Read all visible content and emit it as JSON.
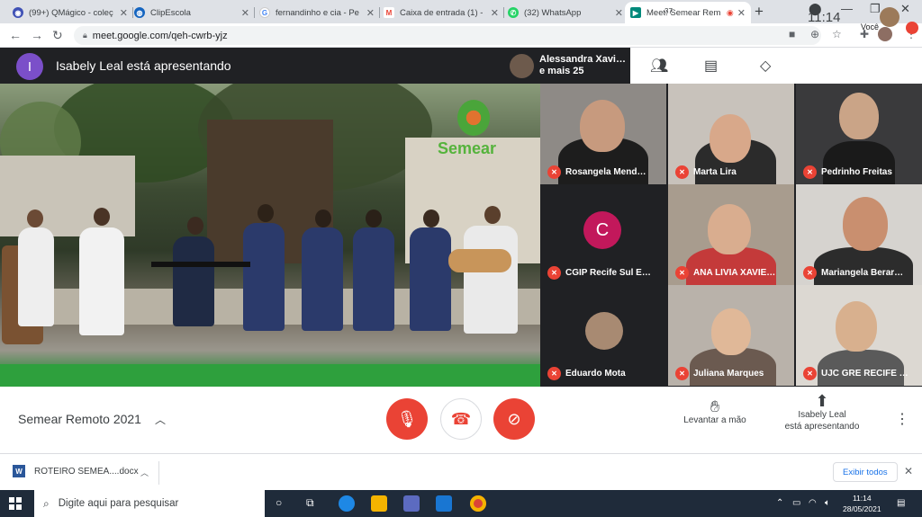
{
  "browser": {
    "tabs": [
      {
        "title": "(99+) QMágico - coleç",
        "favicon": "qmagico-icon",
        "color": "#3f51b5"
      },
      {
        "title": "ClipEscola",
        "favicon": "clipescola-icon",
        "color": "#1565c0"
      },
      {
        "title": "fernandinho e cia - Pe",
        "favicon": "google-icon",
        "color": "#4285f4"
      },
      {
        "title": "Caixa de entrada (1) -",
        "favicon": "gmail-icon",
        "color": "#ea4335"
      },
      {
        "title": "(32) WhatsApp",
        "favicon": "whatsapp-icon",
        "color": "#25d366"
      },
      {
        "title": "Meet: Semear Rem",
        "favicon": "meet-icon",
        "color": "#00897b"
      }
    ],
    "url": "meet.google.com/qeh-cwrb-yjz"
  },
  "meet": {
    "presenter_initial": "I",
    "presenter_banner": "Isabely Leal está apresentando",
    "pinned_name": "Alessandra Xavi…",
    "pinned_more": "e mais 25",
    "participant_count": "37",
    "time": "11:14",
    "self_label": "Você",
    "logo_text": "Semear",
    "tiles": [
      {
        "name": "Rosangela Mend…"
      },
      {
        "name": "Marta Lira"
      },
      {
        "name": "Pedrinho Freitas"
      },
      {
        "name": "CGIP Recife Sul E…",
        "initial": "C"
      },
      {
        "name": "ANA LIVIA XAVIE…"
      },
      {
        "name": "Mariangela Berar…"
      },
      {
        "name": "Eduardo Mota"
      },
      {
        "name": "Juliana Marques"
      },
      {
        "name": "UJC GRE RECIFE …"
      }
    ],
    "meeting_name": "Semear Remoto 2021",
    "raise_hand_label": "Levantar a mão",
    "presenting_line1": "Isabely Leal",
    "presenting_line2": "está apresentando"
  },
  "downloads": {
    "file": "ROTEIRO SEMEA....docx",
    "show_all": "Exibir todos"
  },
  "taskbar": {
    "search_placeholder": "Digite aqui para pesquisar",
    "time": "11:14",
    "date": "28/05/2021"
  }
}
